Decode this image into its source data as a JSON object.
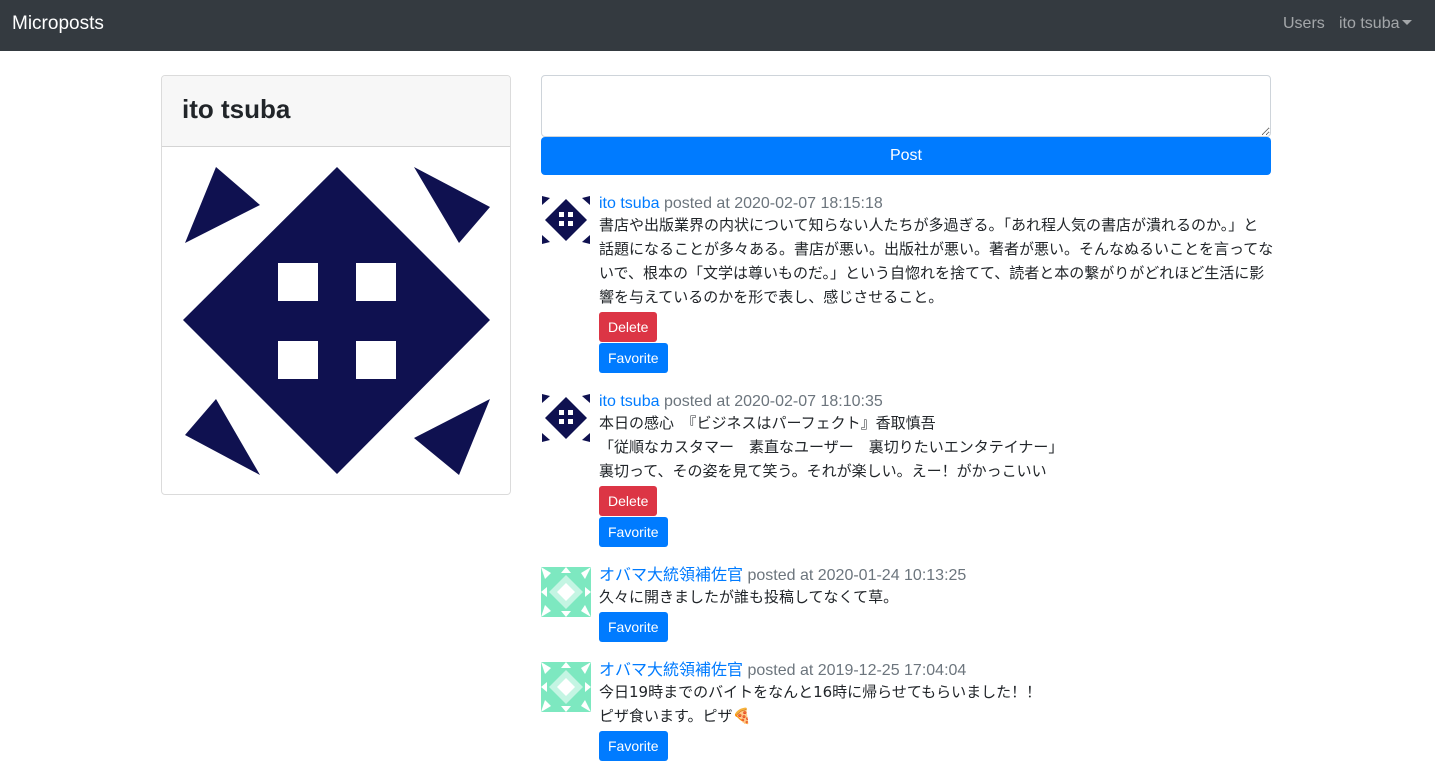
{
  "navbar": {
    "brand": "Microposts",
    "users_link": "Users",
    "user_menu": "ito tsuba"
  },
  "profile": {
    "name": "ito tsuba",
    "avatar_color": "#0f1150"
  },
  "composer": {
    "post_label": "Post"
  },
  "posts": [
    {
      "user": "ito tsuba",
      "posted_at": "posted at 2020-02-07 18:15:18",
      "lines": [
        "書店や出版業界の内状について知らない人たちが多過ぎる。「あれ程人気の書店が潰れるのか。」と",
        "話題になることが多々ある。書店が悪い。出版社が悪い。著者が悪い。そんなぬるいことを言ってな",
        "いで、根本の「文学は尊いものだ。」という自惚れを捨てて、読者と本の繋がりがどれほど生活に影",
        "響を与えているのかを形で表し、感じさせること。"
      ],
      "delete_label": "Delete",
      "favorite_label": "Favorite"
    },
    {
      "user": "ito tsuba",
      "posted_at": "posted at 2020-02-07 18:10:35",
      "lines": [
        "本日の感心　『ビジネスはパーフェクト』香取慎吾",
        "「従順なカスタマー　素直なユーザー　裏切りたいエンタテイナー」",
        "裏切って、その姿を見て笑う。それが楽しい。えー！がかっこいい"
      ],
      "delete_label": "Delete",
      "favorite_label": "Favorite"
    },
    {
      "user": "オバマ大統領補佐官",
      "posted_at": "posted at 2020-01-24 10:13:25",
      "lines": [
        "久々に開きましたが誰も投稿してなくて草。"
      ],
      "favorite_label": "Favorite"
    },
    {
      "user": "オバマ大統領補佐官",
      "posted_at": "posted at 2019-12-25 17:04:04",
      "lines": [
        "今日19時までのバイトをなんと16時に帰らせてもらいました！！",
        "ピザ食います。ピザ🍕"
      ],
      "favorite_label": "Favorite"
    }
  ],
  "colors": {
    "navbar": "#343a40",
    "primary": "#007bff",
    "danger": "#dc3545",
    "identicon_ito": "#0f1150",
    "identicon_obama": "#7de8c0"
  }
}
